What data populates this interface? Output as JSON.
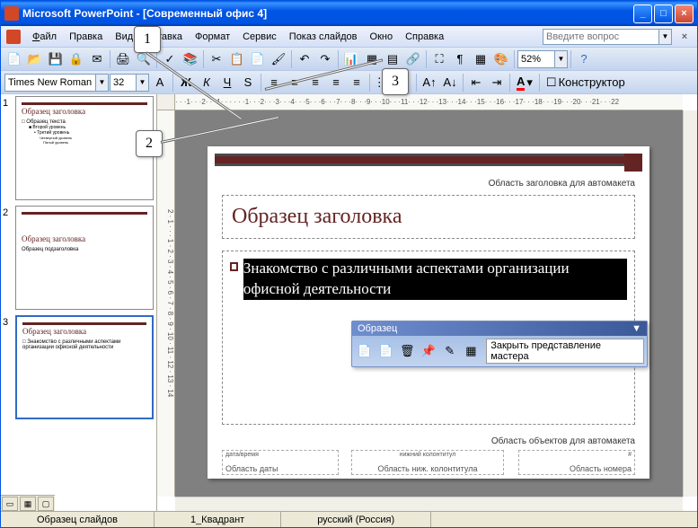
{
  "title": "Microsoft PowerPoint - [Современный офис 4]",
  "menu": {
    "file": "Файл",
    "edit": "Правка",
    "view": "Вид",
    "insert": "Вставка",
    "format": "Формат",
    "tools": "Сервис",
    "slideshow": "Показ слайдов",
    "window": "Окно",
    "help": "Справка"
  },
  "helpPlaceholder": "Введите вопрос",
  "font": {
    "name": "Times New Roman",
    "size": "32"
  },
  "zoom": "52%",
  "designer": "Конструктор",
  "rulerH": "· · ·1· · ·2· · ·1· · · · · ·1· · ·2· · ·3· · ·4· · ·5· · ·6· · ·7· · ·8· · ·9· · ·10· · ·11· · ·12· · ·13· · ·14· · ·15· · ·16· · ·17· · ·18· · ·19· · ·20· · ·21· · ·22",
  "rulerV": "2 · 1 · · · 1 · 2 · 3 · 4 · 5 · 6 · 7 · 8 · 9 · 10 · 11 · 12 · 13 · 14",
  "thumbs": {
    "t1": {
      "title": "Образец заголовка",
      "sub": "Образец текста",
      "l2": "Второй уровень",
      "l3": "Третий уровень",
      "l4": "Четвертый уровень",
      "l5": "Пятый уровень"
    },
    "t2": {
      "title": "Образец заголовка",
      "sub": "Образец подзаголовка"
    },
    "t3": {
      "title": "Образец заголовка",
      "body": "Знакомство с различными аспектами организации офисной деятельности"
    }
  },
  "slide": {
    "titleAreaLabel": "Область заголовка для автомакета",
    "titleText": "Образец заголовка",
    "bodyText": "Знакомство с различными аспектами организации офисной деятельности",
    "objectAreaLabel": "Область объектов для автомакета",
    "dateSmall": "дата/время",
    "dateLabel": "Область даты",
    "footerSmall": "нижний колонтитул",
    "footerLabel": "Область ниж. колонтитула",
    "numSmall": "#",
    "numLabel": "Область номера"
  },
  "masterTb": {
    "title": "Образец",
    "close": "Закрыть представление мастера"
  },
  "status": {
    "left": "Образец слайдов",
    "mid": "1_Квадрант",
    "lang": "русский (Россия)"
  },
  "callouts": {
    "c1": "1",
    "c2": "2",
    "c3": "3"
  }
}
